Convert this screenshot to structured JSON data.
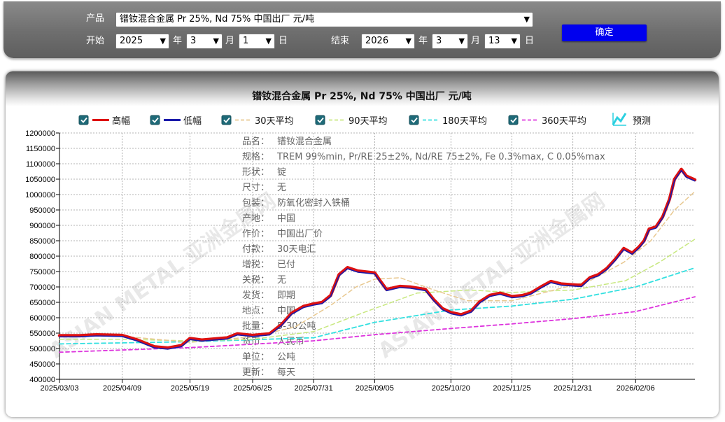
{
  "controls": {
    "product_label": "产品",
    "product_value": "镨钕混合金属 Pr 25%, Nd 75% 中国出厂 元/吨",
    "start_label": "开始",
    "end_label": "结束",
    "year_unit": "年",
    "month_unit": "月",
    "day_unit": "日",
    "start_year": "2025",
    "start_month": "3",
    "start_day": "1",
    "end_year": "2026",
    "end_month": "3",
    "end_day": "13",
    "confirm_label": "确定"
  },
  "colors": {
    "high": "#dd1111",
    "low": "#1a1aaa",
    "ma30": "#e8c890",
    "ma90": "#c8e880",
    "ma180": "#33e0e0",
    "ma360": "#dd33dd",
    "confirm_button": "#0000ee"
  },
  "legend": [
    {
      "key": "high",
      "label": "高幅",
      "style": "solid",
      "checked": true
    },
    {
      "key": "low",
      "label": "低幅",
      "style": "solid",
      "checked": true
    },
    {
      "key": "ma30",
      "label": "30天平均",
      "style": "dashed",
      "checked": true
    },
    {
      "key": "ma90",
      "label": "90天平均",
      "style": "dashed",
      "checked": true
    },
    {
      "key": "ma180",
      "label": "180天平均",
      "style": "dashed",
      "checked": true
    },
    {
      "key": "ma360",
      "label": "360天平均",
      "style": "dashed",
      "checked": true
    }
  ],
  "forecast_label": "预测",
  "forecast_icon": "chart-forecast-icon",
  "info": [
    {
      "key": "品名：",
      "value": "镨钕混合金属"
    },
    {
      "key": "规格：",
      "value": "TREM 99%min, Pr/RE 25±2%, Nd/RE 75±2%, Fe 0.3%max, C 0.05%max"
    },
    {
      "key": "形状：",
      "value": "锭"
    },
    {
      "key": "尺寸：",
      "value": "无"
    },
    {
      "key": "包装：",
      "value": "防氧化密封入铁桶"
    },
    {
      "key": "产地：",
      "value": "中国"
    },
    {
      "key": "作价：",
      "value": "中国出厂价"
    },
    {
      "key": "付款：",
      "value": "30天电汇"
    },
    {
      "key": "增税：",
      "value": "已付"
    },
    {
      "key": "关税：",
      "value": "无"
    },
    {
      "key": "发货：",
      "value": "即期"
    },
    {
      "key": "地点：",
      "value": "中国"
    },
    {
      "key": "批量：",
      "value": "5-30公吨"
    },
    {
      "key": "货币：",
      "value": "人民币"
    },
    {
      "key": "单位：",
      "value": "公吨"
    },
    {
      "key": "更新：",
      "value": "每天"
    }
  ],
  "watermark": "ASIAN METAL 亚洲金属网",
  "chart_data": {
    "type": "line",
    "title": "镨钕混合金属 Pr 25%, Nd 75% 中国出厂 元/吨",
    "x_tick_labels": [
      "2025/03/03",
      "2025/04/09",
      "2025/05/19",
      "2025/06/25",
      "2025/07/31",
      "2025/09/05",
      "2025/10/20",
      "2025/11/25",
      "2025/12/31",
      "2026/02/06"
    ],
    "x_range": [
      "2025/03/03",
      "2026/03/13"
    ],
    "ylim": [
      400000,
      1200000
    ],
    "y_ticks": [
      400000,
      450000,
      500000,
      550000,
      600000,
      650000,
      700000,
      750000,
      800000,
      850000,
      900000,
      950000,
      1000000,
      1050000,
      1100000,
      1150000,
      1200000
    ],
    "grid": true,
    "series": [
      {
        "name": "高幅",
        "key": "high",
        "x": [
          "2025/03/03",
          "2025/03/15",
          "2025/03/25",
          "2025/04/09",
          "2025/04/18",
          "2025/04/28",
          "2025/05/06",
          "2025/05/14",
          "2025/05/19",
          "2025/05/26",
          "2025/06/10",
          "2025/06/16",
          "2025/06/25",
          "2025/07/05",
          "2025/07/12",
          "2025/07/18",
          "2025/07/25",
          "2025/07/31",
          "2025/08/05",
          "2025/08/10",
          "2025/08/15",
          "2025/08/20",
          "2025/08/26",
          "2025/09/05",
          "2025/09/08",
          "2025/09/12",
          "2025/09/20",
          "2025/09/26",
          "2025/10/05",
          "2025/10/10",
          "2025/10/15",
          "2025/10/20",
          "2025/10/26",
          "2025/11/01",
          "2025/11/06",
          "2025/11/12",
          "2025/11/18",
          "2025/11/25",
          "2025/12/01",
          "2025/12/06",
          "2025/12/12",
          "2025/12/18",
          "2025/12/24",
          "2025/12/31",
          "2026/01/05",
          "2026/01/10",
          "2026/01/15",
          "2026/01/20",
          "2026/01/25",
          "2026/01/30",
          "2026/02/04",
          "2026/02/08",
          "2026/02/11",
          "2026/02/14",
          "2026/02/18",
          "2026/02/22",
          "2026/02/26",
          "2026/03/01",
          "2026/03/05",
          "2026/03/08",
          "2026/03/13"
        ],
        "values": [
          542000,
          542000,
          545000,
          543000,
          528000,
          506000,
          502000,
          510000,
          533000,
          528000,
          535000,
          548000,
          543000,
          548000,
          578000,
          615000,
          637000,
          645000,
          650000,
          672000,
          740000,
          763000,
          752000,
          746000,
          722000,
          692000,
          702000,
          700000,
          692000,
          658000,
          630000,
          617000,
          610000,
          622000,
          652000,
          673000,
          680000,
          669000,
          672000,
          680000,
          700000,
          718000,
          710000,
          707000,
          705000,
          730000,
          740000,
          760000,
          790000,
          825000,
          810000,
          830000,
          850000,
          888000,
          895000,
          928000,
          985000,
          1050000,
          1082000,
          1060000,
          1048000
        ]
      },
      {
        "name": "低幅",
        "key": "low",
        "x": [
          "2025/03/03",
          "2025/03/15",
          "2025/03/25",
          "2025/04/09",
          "2025/04/18",
          "2025/04/28",
          "2025/05/06",
          "2025/05/14",
          "2025/05/19",
          "2025/05/26",
          "2025/06/10",
          "2025/06/16",
          "2025/06/25",
          "2025/07/05",
          "2025/07/12",
          "2025/07/18",
          "2025/07/25",
          "2025/07/31",
          "2025/08/05",
          "2025/08/10",
          "2025/08/15",
          "2025/08/20",
          "2025/08/26",
          "2025/09/05",
          "2025/09/08",
          "2025/09/12",
          "2025/09/20",
          "2025/09/26",
          "2025/10/05",
          "2025/10/10",
          "2025/10/15",
          "2025/10/20",
          "2025/10/26",
          "2025/11/01",
          "2025/11/06",
          "2025/11/12",
          "2025/11/18",
          "2025/11/25",
          "2025/12/01",
          "2025/12/06",
          "2025/12/12",
          "2025/12/18",
          "2025/12/24",
          "2025/12/31",
          "2026/01/05",
          "2026/01/10",
          "2026/01/15",
          "2026/01/20",
          "2026/01/25",
          "2026/01/30",
          "2026/02/04",
          "2026/02/08",
          "2026/02/11",
          "2026/02/14",
          "2026/02/18",
          "2026/02/22",
          "2026/02/26",
          "2026/03/01",
          "2026/03/05",
          "2026/03/08",
          "2026/03/13"
        ],
        "values": [
          538000,
          538000,
          541000,
          539000,
          524000,
          502000,
          498000,
          506000,
          529000,
          524000,
          531000,
          544000,
          539000,
          544000,
          574000,
          611000,
          633000,
          641000,
          646000,
          668000,
          736000,
          759000,
          748000,
          742000,
          718000,
          688000,
          698000,
          696000,
          688000,
          654000,
          626000,
          613000,
          606000,
          618000,
          648000,
          669000,
          676000,
          665000,
          668000,
          676000,
          696000,
          714000,
          706000,
          703000,
          701000,
          726000,
          736000,
          756000,
          786000,
          821000,
          806000,
          826000,
          846000,
          884000,
          891000,
          924000,
          981000,
          1046000,
          1078000,
          1056000,
          1044000
        ]
      },
      {
        "name": "30天平均",
        "key": "ma30",
        "x": [
          "2025/03/03",
          "2025/04/09",
          "2025/05/19",
          "2025/06/25",
          "2025/07/20",
          "2025/08/10",
          "2025/08/25",
          "2025/09/05",
          "2025/09/20",
          "2025/10/10",
          "2025/10/30",
          "2025/11/25",
          "2025/12/20",
          "2026/01/10",
          "2026/01/30",
          "2026/02/15",
          "2026/03/01",
          "2026/03/13"
        ],
        "values": [
          545000,
          540000,
          520000,
          538000,
          570000,
          640000,
          700000,
          725000,
          730000,
          690000,
          655000,
          655000,
          690000,
          720000,
          780000,
          850000,
          950000,
          1010000
        ]
      },
      {
        "name": "90天平均",
        "key": "ma90",
        "x": [
          "2025/03/03",
          "2025/04/09",
          "2025/05/19",
          "2025/06/25",
          "2025/07/31",
          "2025/08/31",
          "2025/09/30",
          "2025/10/31",
          "2025/11/25",
          "2025/12/31",
          "2026/01/31",
          "2026/02/20",
          "2026/03/13"
        ],
        "values": [
          530000,
          530000,
          525000,
          530000,
          555000,
          620000,
          680000,
          690000,
          682000,
          690000,
          720000,
          780000,
          855000
        ]
      },
      {
        "name": "180天平均",
        "key": "ma180",
        "x": [
          "2025/03/03",
          "2025/05/19",
          "2025/07/31",
          "2025/09/05",
          "2025/10/20",
          "2025/11/25",
          "2025/12/31",
          "2026/02/06",
          "2026/03/13"
        ],
        "values": [
          515000,
          522000,
          535000,
          585000,
          625000,
          638000,
          660000,
          700000,
          762000
        ]
      },
      {
        "name": "360天平均",
        "key": "ma360",
        "x": [
          "2025/03/03",
          "2025/05/19",
          "2025/07/31",
          "2025/09/05",
          "2025/10/20",
          "2025/11/25",
          "2025/12/31",
          "2026/02/06",
          "2026/03/13"
        ],
        "values": [
          488000,
          503000,
          525000,
          545000,
          565000,
          580000,
          597000,
          620000,
          668000
        ]
      }
    ]
  }
}
